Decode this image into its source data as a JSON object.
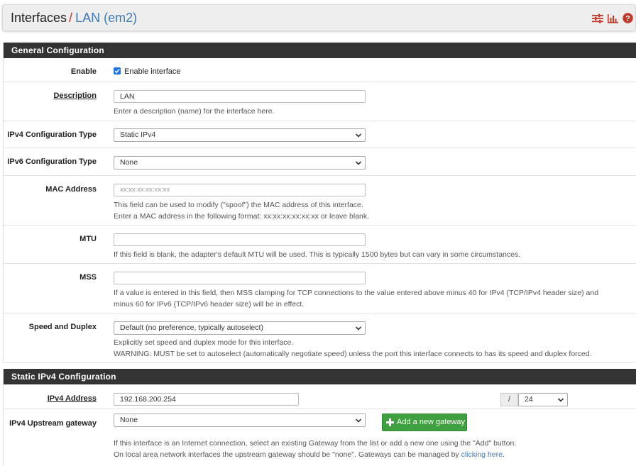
{
  "breadcrumb": {
    "root": "Interfaces",
    "separator": "/",
    "current": "LAN (em2)"
  },
  "header_icons": [
    "settings-sliders-icon",
    "chart-icon",
    "help-icon"
  ],
  "colors": {
    "panel_header": "#333333",
    "link": "#3e7ab6",
    "accent_red": "#c0392b",
    "button_green": "#3ea03e",
    "checkbox": "#1a73e8"
  },
  "general": {
    "title": "General Configuration",
    "enable": {
      "label": "Enable",
      "checkbox_label": "Enable interface",
      "checked": true
    },
    "description": {
      "label": "Description",
      "value": "LAN",
      "help": "Enter a description (name) for the interface here."
    },
    "ipv4_type": {
      "label": "IPv4 Configuration Type",
      "value": "Static IPv4"
    },
    "ipv6_type": {
      "label": "IPv6 Configuration Type",
      "value": "None"
    },
    "mac": {
      "label": "MAC Address",
      "placeholder": "xx:xx:xx:xx:xx:xx",
      "help1": "This field can be used to modify (\"spoof\") the MAC address of this interface.",
      "help2": "Enter a MAC address in the following format: xx:xx:xx:xx:xx:xx or leave blank."
    },
    "mtu": {
      "label": "MTU",
      "value": "",
      "help": "If this field is blank, the adapter's default MTU will be used. This is typically 1500 bytes but can vary in some circumstances."
    },
    "mss": {
      "label": "MSS",
      "value": "",
      "help1": "If a value is entered in this field, then MSS clamping for TCP connections to the value entered above minus 40 for IPv4 (TCP/IPv4 header size) and",
      "help2": "minus 60 for IPv6 (TCP/IPv6 header size) will be in effect."
    },
    "speed": {
      "label": "Speed and Duplex",
      "value": "Default (no preference, typically autoselect)",
      "help1": "Explicitly set speed and duplex mode for this interface.",
      "help2": "WARNING: MUST be set to autoselect (automatically negotiate speed) unless the port this interface connects to has its speed and duplex forced."
    }
  },
  "static_ipv4": {
    "title": "Static IPv4 Configuration",
    "address": {
      "label": "IPv4 Address",
      "value": "192.168.200.254",
      "separator": "/",
      "cidr": "24"
    },
    "gateway": {
      "label": "IPv4 Upstream gateway",
      "value": "None",
      "add_button": "Add a new gateway",
      "help1": "If this interface is an Internet connection, select an existing Gateway from the list or add a new one using the \"Add\" button.",
      "help2_prefix": "On local area network interfaces the upstream gateway should be \"none\". Gateways can be managed by ",
      "help2_link": "clicking here",
      "help2_suffix": "."
    }
  }
}
